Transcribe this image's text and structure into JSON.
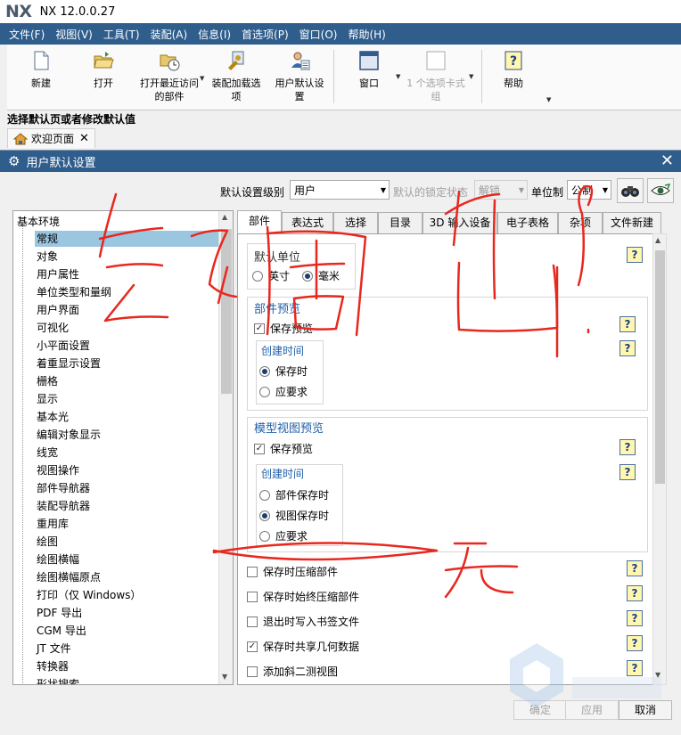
{
  "app": {
    "logo": "NX",
    "title": "NX 12.0.0.27"
  },
  "menu": [
    "文件(F)",
    "视图(V)",
    "工具(T)",
    "装配(A)",
    "信息(I)",
    "首选项(P)",
    "窗口(O)",
    "帮助(H)"
  ],
  "ribbon": {
    "new": "新建",
    "open": "打开",
    "recent_1": "打开最近访问",
    "recent_2": "的部件",
    "load_1": "装配加载选",
    "load_2": "项",
    "user_1": "用户默认设",
    "user_2": "置",
    "window": "窗口",
    "card_1": "1 个选项卡式",
    "card_2": "组",
    "help": "帮助"
  },
  "status_hint": "选择默认页或者修改默认值",
  "doc_tab": "欢迎页面",
  "dialog": {
    "title": "用户默认设置",
    "level_label": "默认设置级别",
    "level_value": "用户",
    "lock_label": "默认的锁定状态",
    "lock_value": "解锁",
    "unit_label": "单位制",
    "unit_value": "公制",
    "ok": "确定",
    "apply": "应用",
    "cancel": "取消"
  },
  "tree": {
    "root": "基本环境",
    "items": [
      "常规",
      "对象",
      "用户属性",
      "单位类型和量纲",
      "用户界面",
      "可视化",
      "小平面设置",
      "着重显示设置",
      "栅格",
      "显示",
      "基本光",
      "编辑对象显示",
      "线宽",
      "视图操作",
      "部件导航器",
      "装配导航器",
      "重用库",
      "绘图",
      "绘图横幅",
      "绘图横幅原点",
      "打印（仅 Windows）",
      "PDF 导出",
      "CGM 导出",
      "JT 文件",
      "转换器",
      "形状搜索"
    ]
  },
  "tabs": [
    "部件",
    "表达式",
    "选择",
    "目录",
    "3D 输入设备",
    "电子表格",
    "杂项",
    "文件新建"
  ],
  "panel": {
    "unit_group": "默认单位",
    "unit_inch": "英寸",
    "unit_mm": "毫米",
    "preview_group": "部件预览",
    "save_preview": "保存预览",
    "create_time": "创建时间",
    "on_save": "保存时",
    "on_request": "应要求",
    "model_group": "模型视图预览",
    "model_save_preview": "保存预览",
    "model_create_time": "创建时间",
    "part_save": "部件保存时",
    "view_save": "视图保存时",
    "model_request": "应要求",
    "compress_on_save": "保存时压缩部件",
    "always_compress": "保存时始终压缩部件",
    "bookmark": "退出时写入书签文件",
    "share_geom": "保存时共享几何数据",
    "add_iso": "添加斜二测视图",
    "help": "?"
  }
}
